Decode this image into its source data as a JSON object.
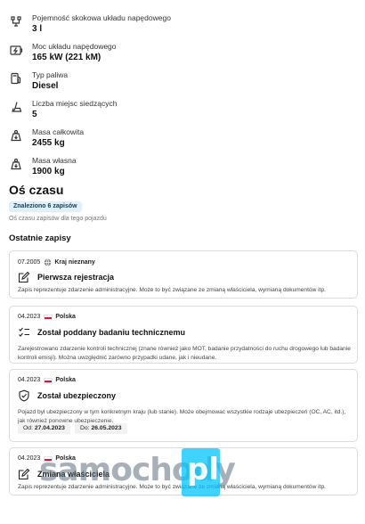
{
  "specs": [
    {
      "icon": "engine-icon",
      "label": "Pojemność skokowa układu napędowego",
      "value": "3 l"
    },
    {
      "icon": "battery-power-icon",
      "label": "Moc układu napędowego",
      "value": "165 kW (221 kM)"
    },
    {
      "icon": "fuel-pump-icon",
      "label": "Typ paliwa",
      "value": "Diesel"
    },
    {
      "icon": "seat-icon",
      "label": "Liczba miejsc siedzących",
      "value": "5"
    },
    {
      "icon": "weight-icon",
      "label": "Masa całkowita",
      "value": "2455 kg"
    },
    {
      "icon": "weight-icon",
      "label": "Masa własna",
      "value": "1900 kg"
    }
  ],
  "timeline": {
    "title": "Oś czasu",
    "badge": "Znaleziono 6 zapisów",
    "subnote": "Oś czasu zapisów dla tego pojazdu"
  },
  "recent": {
    "title": "Ostatnie zapisy",
    "events": [
      {
        "date": "07.2005",
        "country": "Kraj nieznany",
        "country_icon": "globe-icon",
        "icon": "edit-document-icon",
        "title": "Pierwsza rejestracja",
        "desc": "Zapis reprezentuje zdarzenie administracyjne. Może to być związane ze zmianą właściciela, wymianą dokumentów itp."
      },
      {
        "date": "04.2023",
        "country": "Polska",
        "country_icon": "poland-flag-icon",
        "icon": "checklist-icon",
        "title": "Został poddany badaniu technicznemu",
        "desc": "Zarejestrowano zdarzenie kontroli technicznej (znane również jako MOT, badanie przydatności do ruchu drogowego lub badanie kontroli emisji). Można uwzględnić zarówno przypadki udane, jak i nieudane."
      },
      {
        "date": "04.2023",
        "country": "Polska",
        "country_icon": "poland-flag-icon",
        "icon": "shield-check-icon",
        "title": "Został ubezpieczony",
        "desc": "Pojazd był ubezpieczony w tym konkretnym kraju (lub stanie). Może obejmować wszystkie rodzaje ubezpieczeń (OC, AC, itd.), jak również ponowne ubezpieczenie.",
        "from_label": "Od:",
        "from_value": "27.04.2023",
        "to_label": "Do:",
        "to_value": "26.05.2023"
      },
      {
        "date": "04.2023",
        "country": "Polska",
        "country_icon": "poland-flag-icon",
        "icon": "edit-document-icon",
        "title": "Zmiana właściciela",
        "desc": "Zapis reprezentuje zdarzenie administracyjne. Może to być związane ze zmianą właściciela, wymianą dokumentów itp."
      }
    ]
  },
  "watermark": {
    "text": "samochody",
    "suffix": "pl"
  },
  "colors": {
    "badge_bg": "#dff0fa",
    "badge_text": "#1a3a55",
    "border": "#dcdcdc",
    "flag_red": "#dc143c",
    "watermark_blue": "#00c4ff"
  }
}
